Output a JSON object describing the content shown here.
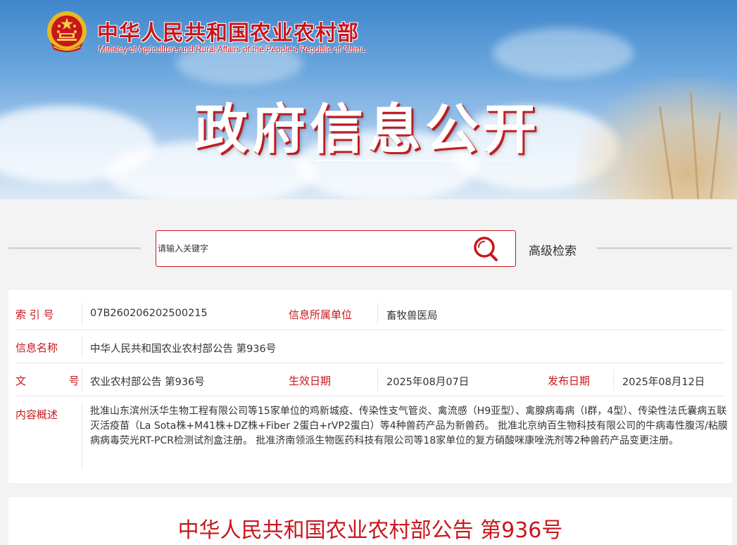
{
  "header": {
    "site_name_cn": "中华人民共和国农业农村部",
    "site_name_en": "Ministry of Agriculture and Rural Affairs of the People's Republic of China",
    "hero_title": "政府信息公开",
    "emblem_icon": "national-emblem-icon"
  },
  "search": {
    "placeholder": "请输入关键字",
    "search_icon": "search-icon",
    "advanced_label": "高级检索"
  },
  "info": {
    "index_label": "索 引 号",
    "index_value": "07B260206202500215",
    "dept_label": "信息所属单位",
    "dept_value": "畜牧兽医局",
    "name_label": "信息名称",
    "name_value": "中华人民共和国农业农村部公告 第936号",
    "doc_label": "文 号",
    "doc_value": "农业农村部公告 第936号",
    "effective_label": "生效日期",
    "effective_value": "2025年08月07日",
    "publish_label": "发布日期",
    "publish_value": "2025年08月12日",
    "summary_label": "内容概述",
    "summary_value": "批准山东滨州沃华生物工程有限公司等15家单位的鸡新城疫、传染性支气管炎、禽流感（H9亚型）、禽腺病毒病（I群，4型）、传染性法氏囊病五联灭活疫苗（La Sota株+M41株+DZ株+Fiber 2蛋白+rVP2蛋白）等4种兽药产品为新兽药。 批准北京纳百生物科技有限公司的牛病毒性腹泻/粘膜病病毒荧光RT-PCR检测试剂盒注册。 批准济南领派生物医药科技有限公司等18家单位的复方硝酸咪康唑洗剂等2种兽药产品变更注册。"
  },
  "article": {
    "title": "中华人民共和国农业农村部公告 第936号"
  },
  "colors": {
    "accent": "#c8161d",
    "text": "#333333",
    "page_bg": "#f3f3f3"
  }
}
